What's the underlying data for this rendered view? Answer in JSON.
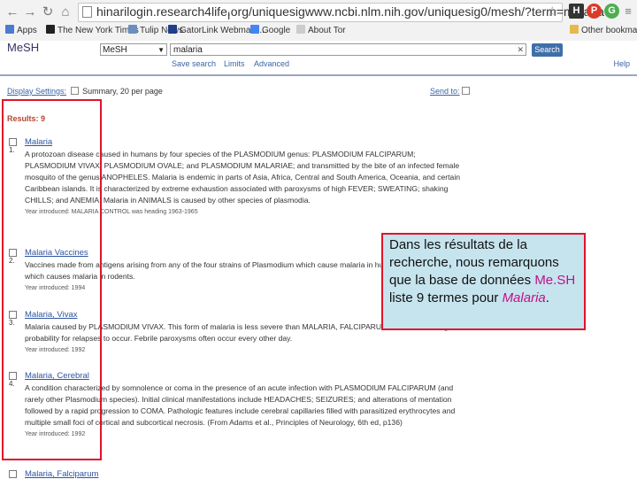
{
  "browser": {
    "url": "hinarilogin.research4life.org/uniquesigwww.ncbi.nlm.nih.gov/uniquesig0/mesh/?term=malaria",
    "extensions": [
      "H",
      "P",
      "G"
    ],
    "bookmarks": [
      "Apps",
      "The New York Times",
      "Tulip News",
      "GatorLink Webmail ...",
      "Google",
      "About Tor"
    ],
    "other_bookmarks": "Other bookmark"
  },
  "search": {
    "logo": "MeSH",
    "database": "MeSH",
    "query": "malaria",
    "button": "Search",
    "links": [
      "Save search",
      "Limits",
      "Advanced"
    ],
    "help": "Help"
  },
  "display": {
    "settings_label": "Display Settings:",
    "settings_value": "Summary, 20 per page",
    "send_to": "Send to:"
  },
  "results_label": "Results: 9",
  "results": [
    {
      "num": "1.",
      "title": "Malaria",
      "desc": "A protozoan disease caused in humans by four species of the PLASMODIUM genus: PLASMODIUM FALCIPARUM; PLASMODIUM VIVAX; PLASMODIUM OVALE; and PLASMODIUM MALARIAE; and transmitted by the bite of an infected female mosquito of the genus ANOPHELES. Malaria is endemic in parts of Asia, Africa, Central and South America, Oceania, and certain Caribbean islands. It is characterized by extreme exhaustion associated with paroxysms of high FEVER; SWEATING; shaking CHILLS; and ANEMIA. Malaria in ANIMALS is caused by other species of plasmodia.",
      "year": "Year introduced: MALARIA CONTROL was heading 1963-1965"
    },
    {
      "num": "2.",
      "title": "Malaria Vaccines",
      "desc": "Vaccines made from antigens arising from any of the four strains of Plasmodium which cause malaria in humans, or from P. berghei which causes malaria in rodents.",
      "year": "Year introduced: 1994"
    },
    {
      "num": "3.",
      "title": "Malaria, Vivax",
      "desc": "Malaria caused by PLASMODIUM VIVAX. This form of malaria is less severe than MALARIA, FALCIPARUM, but there is a higher probability for relapses to occur. Febrile paroxysms often occur every other day.",
      "year": "Year introduced: 1992"
    },
    {
      "num": "4.",
      "title": "Malaria, Cerebral",
      "desc": "A condition characterized by somnolence or coma in the presence of an acute infection with PLASMODIUM FALCIPARUM (and rarely other Plasmodium species). Initial clinical manifestations include HEADACHES; SEIZURES; and alterations of mentation followed by a rapid progression to COMA. Pathologic features include cerebral capillaries filled with parasitized erythrocytes and multiple small foci of cortical and subcortical necrosis. (From Adams et al., Principles of Neurology, 6th ed, p136)",
      "year": "Year introduced: 1992"
    },
    {
      "num": "",
      "title": "Malaria, Falciparum",
      "desc": "",
      "year": ""
    }
  ],
  "callout": {
    "part1": "Dans les résultats de la recherche, nous remarquons que la base de données ",
    "highlight": "Me.SH",
    "part2": " liste 9 termes pour ",
    "italic": "Malaria",
    "part3": "."
  },
  "colors": {
    "annotation_border": "#e0142a",
    "callout_bg": "#c6e4ee",
    "link": "#2e55a0",
    "highlight": "#c0108a"
  }
}
